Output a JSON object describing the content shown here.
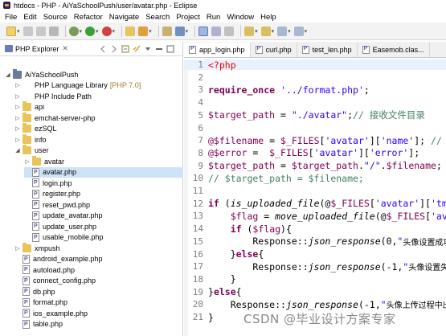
{
  "window": {
    "title": "htdocs - PHP - AiYaSchoolPush/user/avatar.php - Eclipse"
  },
  "menu": [
    "File",
    "Edit",
    "Source",
    "Refactor",
    "Navigate",
    "Search",
    "Project",
    "Run",
    "Window",
    "Help"
  ],
  "explorer": {
    "tab_label": "PHP Explorer",
    "close_glyph": "✕",
    "tree": [
      {
        "label": "AiYaSchoolPush",
        "depth": 0,
        "type": "project",
        "expanded": true
      },
      {
        "label": "PHP Language Library",
        "suffix": "[PHP 7.0]",
        "depth": 1,
        "type": "library",
        "expanded": false
      },
      {
        "label": "PHP Include Path",
        "depth": 1,
        "type": "library",
        "expanded": false
      },
      {
        "label": "api",
        "depth": 1,
        "type": "folder",
        "expanded": false
      },
      {
        "label": "emchat-server-php",
        "depth": 1,
        "type": "folder",
        "expanded": false
      },
      {
        "label": "ezSQL",
        "depth": 1,
        "type": "folder",
        "expanded": false
      },
      {
        "label": "info",
        "depth": 1,
        "type": "folder",
        "expanded": false
      },
      {
        "label": "user",
        "depth": 1,
        "type": "folder",
        "expanded": true
      },
      {
        "label": "avatar",
        "depth": 2,
        "type": "folder",
        "expanded": false
      },
      {
        "label": "avatar.php",
        "depth": 2,
        "type": "file",
        "expanded": false,
        "selected": true
      },
      {
        "label": "login.php",
        "depth": 2,
        "type": "file",
        "expanded": false
      },
      {
        "label": "register.php",
        "depth": 2,
        "type": "file",
        "expanded": false
      },
      {
        "label": "reset_pwd.php",
        "depth": 2,
        "type": "file",
        "expanded": false
      },
      {
        "label": "update_avatar.php",
        "depth": 2,
        "type": "file",
        "expanded": false
      },
      {
        "label": "update_user.php",
        "depth": 2,
        "type": "file",
        "expanded": false
      },
      {
        "label": "usable_mobile.php",
        "depth": 2,
        "type": "file",
        "expanded": false
      },
      {
        "label": "xmpush",
        "depth": 1,
        "type": "folder",
        "expanded": false
      },
      {
        "label": "android_example.php",
        "depth": 1,
        "type": "file",
        "expanded": false
      },
      {
        "label": "autoload.php",
        "depth": 1,
        "type": "file",
        "expanded": false
      },
      {
        "label": "connect_config.php",
        "depth": 1,
        "type": "file",
        "expanded": false
      },
      {
        "label": "db.php",
        "depth": 1,
        "type": "file",
        "expanded": false
      },
      {
        "label": "format.php",
        "depth": 1,
        "type": "file",
        "expanded": false
      },
      {
        "label": "ios_example.php",
        "depth": 1,
        "type": "file",
        "expanded": false
      },
      {
        "label": "table.php",
        "depth": 1,
        "type": "file",
        "expanded": false
      }
    ]
  },
  "editor": {
    "tabs": [
      "app_login.php",
      "curl.php",
      "test_len.php",
      "Easemob.clas..."
    ],
    "close_glyph": "✕",
    "line_numbers": [
      "1",
      "2",
      "3",
      "4",
      "5",
      "6",
      "7",
      "8",
      "9",
      "10",
      "11",
      "12",
      "13",
      "14",
      "15",
      "16",
      "17",
      "18",
      "19",
      "20",
      "21"
    ],
    "lines": [
      [
        {
          "t": "<?php",
          "c": "c-tag"
        }
      ],
      [],
      [
        {
          "t": "require_once",
          "c": "c-kw"
        },
        {
          "t": " "
        },
        {
          "t": "'../format.php'",
          "c": "c-str"
        },
        {
          "t": ";"
        }
      ],
      [],
      [
        {
          "t": "$target_path",
          "c": "c-var"
        },
        {
          "t": " = "
        },
        {
          "t": "\"./avatar\"",
          "c": "c-str"
        },
        {
          "t": ";"
        },
        {
          "t": "// ",
          "c": "c-cm"
        },
        {
          "t": "接收文件目录",
          "c": "c-cm"
        }
      ],
      [],
      [
        {
          "t": "@$filename",
          "c": "c-var"
        },
        {
          "t": " = "
        },
        {
          "t": "$_FILES",
          "c": "c-var"
        },
        {
          "t": "["
        },
        {
          "t": "'avatar'",
          "c": "c-str"
        },
        {
          "t": "]["
        },
        {
          "t": "'name'",
          "c": "c-str"
        },
        {
          "t": "]; "
        },
        {
          "t": "//",
          "c": "c-cm"
        }
      ],
      [
        {
          "t": "@$error",
          "c": "c-var"
        },
        {
          "t": " =  "
        },
        {
          "t": "$_FILES",
          "c": "c-var"
        },
        {
          "t": "["
        },
        {
          "t": "'avatar'",
          "c": "c-str"
        },
        {
          "t": "]["
        },
        {
          "t": "'error'",
          "c": "c-str"
        },
        {
          "t": "];"
        }
      ],
      [
        {
          "t": "$target_path",
          "c": "c-var"
        },
        {
          "t": " = "
        },
        {
          "t": "$target_path",
          "c": "c-var"
        },
        {
          "t": "."
        },
        {
          "t": "\"/\"",
          "c": "c-str"
        },
        {
          "t": "."
        },
        {
          "t": "$filename",
          "c": "c-var"
        },
        {
          "t": ";"
        }
      ],
      [
        {
          "t": "// $target_path = $filename;",
          "c": "c-cm"
        }
      ],
      [],
      [
        {
          "t": "if",
          "c": "c-kw"
        },
        {
          "t": " ("
        },
        {
          "t": "is_uploaded_file",
          "c": "c-fn"
        },
        {
          "t": "(@"
        },
        {
          "t": "$_FILES",
          "c": "c-var"
        },
        {
          "t": "["
        },
        {
          "t": "'avatar'",
          "c": "c-str"
        },
        {
          "t": "]["
        },
        {
          "t": "'tm",
          "c": "c-str"
        }
      ],
      [
        {
          "t": "    "
        },
        {
          "t": "$flag",
          "c": "c-var"
        },
        {
          "t": " = "
        },
        {
          "t": "move_uploaded_file",
          "c": "c-fn"
        },
        {
          "t": "(@"
        },
        {
          "t": "$_FILES",
          "c": "c-var"
        },
        {
          "t": "["
        },
        {
          "t": "'av",
          "c": "c-str"
        }
      ],
      [
        {
          "t": "    "
        },
        {
          "t": "if",
          "c": "c-kw"
        },
        {
          "t": " ("
        },
        {
          "t": "$flag",
          "c": "c-var"
        },
        {
          "t": "){"
        }
      ],
      [
        {
          "t": "        Response::"
        },
        {
          "t": "json_response",
          "c": "c-fn"
        },
        {
          "t": "(0,"
        },
        {
          "t": "\"",
          "c": "c-str"
        },
        {
          "t": "头像设置成功",
          "c": "c-str c-cn"
        }
      ],
      [
        {
          "t": "    }"
        },
        {
          "t": "else",
          "c": "c-kw"
        },
        {
          "t": "{"
        }
      ],
      [
        {
          "t": "        Response::"
        },
        {
          "t": "json_response",
          "c": "c-fn"
        },
        {
          "t": "(-1,"
        },
        {
          "t": "\"",
          "c": "c-str"
        },
        {
          "t": "头像设置失",
          "c": "c-str c-cn"
        }
      ],
      [
        {
          "t": "    }"
        }
      ],
      [
        {
          "t": "}"
        },
        {
          "t": "else",
          "c": "c-kw"
        },
        {
          "t": "{"
        }
      ],
      [
        {
          "t": "    Response::"
        },
        {
          "t": "json_response",
          "c": "c-fn"
        },
        {
          "t": "(-1,"
        },
        {
          "t": "\"",
          "c": "c-str"
        },
        {
          "t": "头像上传过程中出",
          "c": "c-str c-cn"
        }
      ],
      [
        {
          "t": "}"
        }
      ]
    ]
  },
  "watermark": "CSDN @毕业设计方案专家"
}
